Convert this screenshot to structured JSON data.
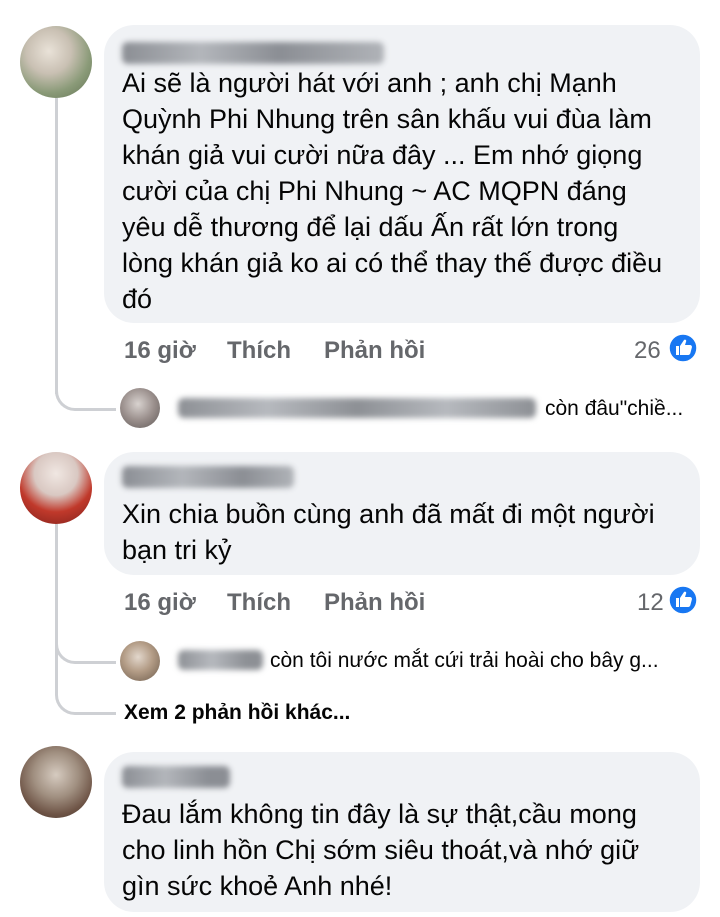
{
  "comments": [
    {
      "author": "Hai Thung Phi Nhung",
      "lines": [
        "Ai sẽ là người hát với anh ; anh chị Mạnh",
        "Quỳnh Phi Nhung trên sân khấu vui đùa làm",
        "khán giả vui cười nữa đây ... Em nhớ giọng",
        "cười của chị Phi Nhung ~ AC MQPN đáng",
        "yêu dễ thương để lại dấu Ấn rất lớn trong",
        "lòng khán giả ko ai có thể thay thế được điều",
        "đó"
      ],
      "time": "16 giờ",
      "like_label": "Thích",
      "reply_label": "Phản hồi",
      "reaction_count": "26",
      "reply_preview": {
        "author": "Anh Nguoi Hai Thung Phi Nhung",
        "text": "còn đâu\"chiề..."
      }
    },
    {
      "author": "Phuong Hoang",
      "lines": [
        "Xin chia buồn cùng anh đã mất đi một người",
        "bạn tri kỷ"
      ],
      "time": "16 giờ",
      "like_label": "Thích",
      "reply_label": "Phản hồi",
      "reaction_count": "12",
      "reply_preview": {
        "author": "Thao Le",
        "text": "còn tôi nước mắt cứi trải hoài cho bây g..."
      },
      "more_replies": "Xem 2 phản hồi khác..."
    },
    {
      "author": "Hoai Thu",
      "lines": [
        "Đau lắm không tin đây là sự thật,cầu mong",
        "cho linh hồn Chị sớm siêu thoát,và nhớ giữ",
        "gìn sức khoẻ Anh nhé!"
      ]
    }
  ],
  "colors": {
    "bubble": "#f0f2f5",
    "meta_text": "#65676b",
    "like_blue": "#1877f2",
    "thread_line": "#ced0d4"
  },
  "icons": {
    "like": "thumbs-up-icon"
  }
}
